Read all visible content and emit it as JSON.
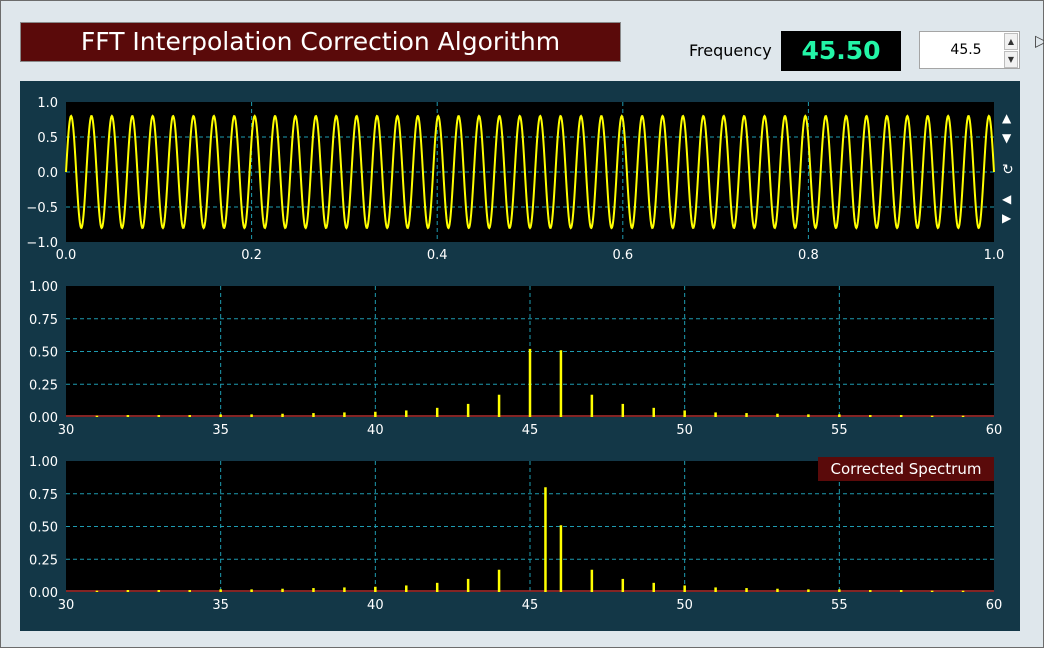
{
  "window": {
    "title": "FFT Interpolation Correction Algorithm",
    "frequency_label": "Frequency",
    "frequency_display": "45.50",
    "frequency_input": "45.5"
  },
  "icons": {
    "spin_up": "triangle-up-icon",
    "spin_down": "triangle-down-icon",
    "pan_up": "triangle-up-icon",
    "pan_down": "triangle-down-icon",
    "reset": "refresh-icon",
    "pan_left": "triangle-left-icon",
    "pan_right": "triangle-right-icon"
  },
  "colors": {
    "title_bg": "#5a0a0a",
    "panel_bg": "#133747",
    "plot_bg": "#000000",
    "trace": "#ffff00",
    "grid": "#1e9bb0",
    "baseline": "#b03030",
    "display_text": "#23f5a7"
  },
  "chart_data": [
    {
      "type": "line",
      "xlim": [
        0,
        1
      ],
      "ylim": [
        -1,
        1
      ],
      "xticks": [
        "0.0",
        "0.2",
        "0.4",
        "0.6",
        "0.8",
        "1.0"
      ],
      "yticks": [
        "1.0",
        "0.5",
        "0.0",
        "−0.5",
        "−1.0"
      ],
      "signal": {
        "frequency": 45.5,
        "amplitude": 0.8
      },
      "grid": true
    },
    {
      "type": "bar",
      "xlim": [
        30,
        60
      ],
      "ylim": [
        0,
        1
      ],
      "xticks": [
        "30",
        "35",
        "40",
        "45",
        "50",
        "55",
        "60"
      ],
      "yticks": [
        "1.00",
        "0.75",
        "0.50",
        "0.25",
        "0.00"
      ],
      "x": [
        31,
        32,
        33,
        34,
        35,
        36,
        37,
        38,
        39,
        40,
        41,
        42,
        43,
        44,
        45,
        46,
        47,
        48,
        49,
        50,
        51,
        52,
        53,
        54,
        55,
        56,
        57,
        58,
        59
      ],
      "values": [
        0.01,
        0.015,
        0.015,
        0.015,
        0.02,
        0.02,
        0.025,
        0.03,
        0.035,
        0.04,
        0.05,
        0.07,
        0.1,
        0.17,
        0.52,
        0.51,
        0.17,
        0.1,
        0.07,
        0.05,
        0.035,
        0.03,
        0.025,
        0.02,
        0.02,
        0.015,
        0.015,
        0.01,
        0.01
      ],
      "grid": true
    },
    {
      "type": "bar",
      "xlim": [
        30,
        60
      ],
      "ylim": [
        0,
        1
      ],
      "xticks": [
        "30",
        "35",
        "40",
        "45",
        "50",
        "55",
        "60"
      ],
      "yticks": [
        "1.00",
        "0.75",
        "0.50",
        "0.25",
        "0.00"
      ],
      "legend": "Corrected Spectrum",
      "legend_position": "top-right",
      "x": [
        31,
        32,
        33,
        34,
        35,
        36,
        37,
        38,
        39,
        40,
        41,
        42,
        43,
        44,
        45.5,
        46,
        47,
        48,
        49,
        50,
        51,
        52,
        53,
        54,
        55,
        56,
        57,
        58,
        59
      ],
      "values": [
        0.01,
        0.015,
        0.015,
        0.015,
        0.02,
        0.02,
        0.025,
        0.03,
        0.035,
        0.04,
        0.05,
        0.07,
        0.1,
        0.17,
        0.8,
        0.51,
        0.17,
        0.1,
        0.07,
        0.05,
        0.035,
        0.03,
        0.025,
        0.02,
        0.02,
        0.015,
        0.015,
        0.01,
        0.01
      ],
      "grid": true
    }
  ]
}
